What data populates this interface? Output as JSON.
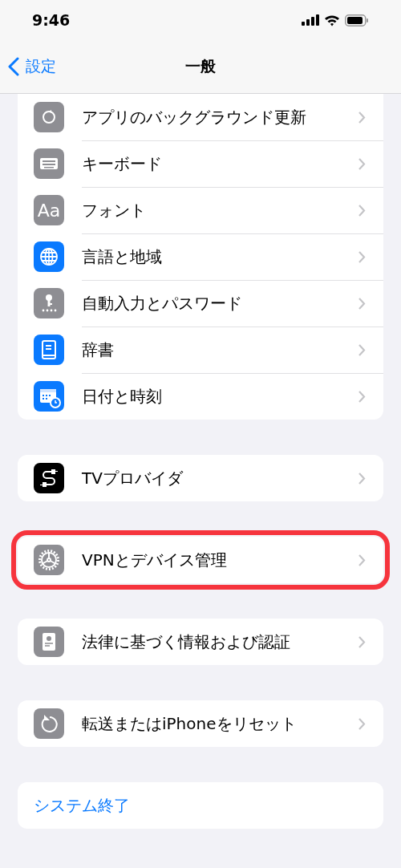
{
  "status_bar": {
    "time": "9:46"
  },
  "nav": {
    "back": "設定",
    "title": "一般"
  },
  "groups": [
    {
      "items": [
        {
          "label": "アプリのバックグラウンド更新",
          "highlighted": false
        },
        {
          "label": "キーボード",
          "highlighted": false
        },
        {
          "label": "フォント",
          "icon_text": "Aa",
          "highlighted": false
        },
        {
          "label": "言語と地域",
          "highlighted": false
        },
        {
          "label": "自動入力とパスワード",
          "highlighted": false
        },
        {
          "label": "辞書",
          "highlighted": false
        },
        {
          "label": "日付と時刻",
          "highlighted": false
        }
      ]
    },
    {
      "items": [
        {
          "label": "TVプロバイダ",
          "highlighted": false
        }
      ]
    },
    {
      "items": [
        {
          "label": "VPNとデバイス管理",
          "highlighted": true
        }
      ]
    },
    {
      "items": [
        {
          "label": "法律に基づく情報および認証",
          "highlighted": false
        }
      ]
    },
    {
      "items": [
        {
          "label": "転送またはiPhoneをリセット",
          "highlighted": false
        }
      ]
    },
    {
      "items": [
        {
          "label": "システム終了",
          "kind": "action",
          "highlighted": false
        }
      ]
    }
  ]
}
